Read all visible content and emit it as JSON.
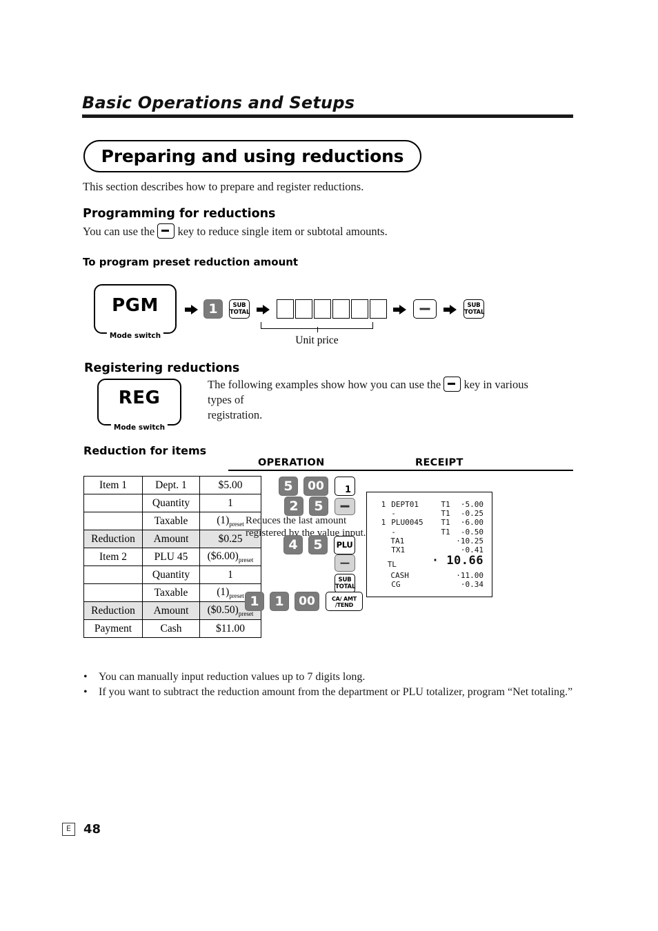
{
  "running_head": {
    "title": "Basic Operations and Setups"
  },
  "banner": {
    "title": "Preparing and using reductions"
  },
  "intro": "This section describes how to prepare and register reductions.",
  "sections": {
    "programming": {
      "heading": "Programming for reductions",
      "text_before_key": "You can use the",
      "text_after_key": "key to reduce single item or subtotal amounts.",
      "subheading": "To program preset reduction amount",
      "mode_switch": {
        "name": "PGM",
        "label": "Mode switch"
      },
      "sequence": {
        "dept_key": "1",
        "subtotal_key_line1": "SUB",
        "subtotal_key_line2": "TOTAL",
        "digit_box_count": 6,
        "brace_label": "Unit price"
      }
    },
    "registering": {
      "heading": "Registering reductions",
      "mode_switch": {
        "name": "REG",
        "label": "Mode switch"
      },
      "text_before_key": "The following examples show how you can use the",
      "text_after_key": "key in various types of",
      "text_line2": "registration."
    },
    "example": {
      "heading": "Reduction for items",
      "col_operation": "OPERATION",
      "col_receipt": "RECEIPT",
      "table_rows": [
        {
          "label": "Item 1",
          "field": "Dept. 1",
          "value": "$5.00",
          "value_sub": "",
          "shaded": false
        },
        {
          "label": "",
          "field": "Quantity",
          "value": "1",
          "value_sub": "",
          "shaded": false
        },
        {
          "label": "",
          "field": "Taxable",
          "value": "(1)",
          "value_sub": "preset",
          "shaded": false
        },
        {
          "label": "Reduction",
          "field": "Amount",
          "value": "$0.25",
          "value_sub": "",
          "shaded": true
        },
        {
          "label": "Item 2",
          "field": "PLU 45",
          "value": "($6.00)",
          "value_sub": "preset",
          "shaded": false
        },
        {
          "label": "",
          "field": "Quantity",
          "value": "1",
          "value_sub": "",
          "shaded": false
        },
        {
          "label": "",
          "field": "Taxable",
          "value": "(1)",
          "value_sub": "preset",
          "shaded": false
        },
        {
          "label": "Reduction",
          "field": "Amount",
          "value": "($0.50)",
          "value_sub": "preset",
          "shaded": true
        },
        {
          "label": "Payment",
          "field": "Cash",
          "value": "$11.00",
          "value_sub": "",
          "shaded": false
        }
      ],
      "operation": {
        "row1": {
          "k1": "5",
          "k2": "00",
          "dept": "1"
        },
        "row2": {
          "k1": "2",
          "k2": "5"
        },
        "note_line1": "Reduces the last amount",
        "note_line2": "registered by the value input.",
        "row3": {
          "k1": "4",
          "k2": "5",
          "plu": "PLU"
        },
        "subtotal_line1": "SUB",
        "subtotal_line2": "TOTAL",
        "row4": {
          "k1": "1",
          "k2": "1",
          "k3": "00"
        },
        "ca_line1": "CA/ AMT",
        "ca_line2": "/TEND"
      },
      "receipt_lines": [
        {
          "qty": "1",
          "desc": "DEPT01",
          "tax": "T1",
          "amt": "·5.00",
          "big": false
        },
        {
          "qty": "",
          "desc": "-",
          "tax": "T1",
          "amt": "-0.25",
          "big": false
        },
        {
          "qty": "1",
          "desc": "PLU0045",
          "tax": "T1",
          "amt": "·6.00",
          "big": false
        },
        {
          "qty": "",
          "desc": "-",
          "tax": "T1",
          "amt": "-0.50",
          "big": false
        },
        {
          "qty": "",
          "desc": "TA1",
          "tax": "",
          "amt": "·10.25",
          "big": false
        },
        {
          "qty": "",
          "desc": "TX1",
          "tax": "",
          "amt": "·0.41",
          "big": false
        },
        {
          "qty": "",
          "desc": "TL",
          "tax": "",
          "amt": "· 10.66",
          "big": true
        },
        {
          "qty": "",
          "desc": "CASH",
          "tax": "",
          "amt": "·11.00",
          "big": false
        },
        {
          "qty": "",
          "desc": "CG",
          "tax": "",
          "amt": "·0.34",
          "big": false
        }
      ]
    }
  },
  "bullets": [
    "You can manually input reduction values up to 7 digits long.",
    "If you want to subtract the reduction amount from the department or PLU totalizer, program “Net totaling.”"
  ],
  "bullet_marker": "•",
  "footer": {
    "lang": "E",
    "page": "48"
  }
}
